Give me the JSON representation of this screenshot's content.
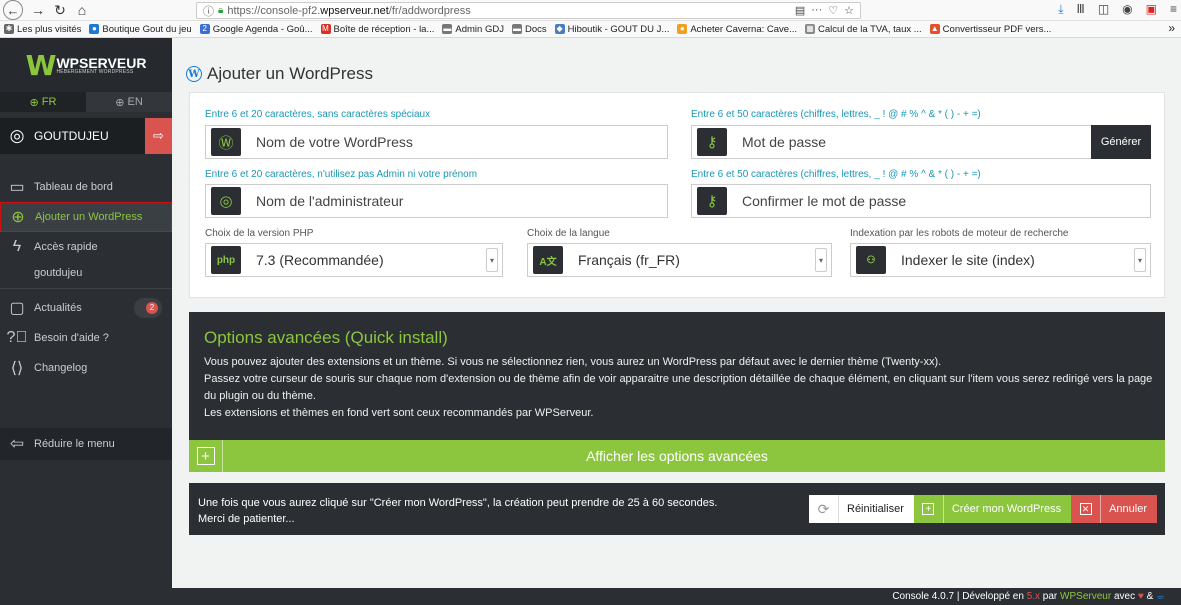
{
  "browser": {
    "url_prefix": "https://console-pf2.",
    "url_domain": "wpserveur.net",
    "url_path": "/fr/addwordpress",
    "bookmarks": [
      {
        "label": "Les plus visités",
        "icon": "gear-icon",
        "color": "#666666"
      },
      {
        "label": "Boutique Gout du jeu",
        "icon": "globe-icon",
        "color": "#1b7ad3"
      },
      {
        "label": "Google Agenda - Goû...",
        "icon": "calendar-icon",
        "color": "#3b6fd4"
      },
      {
        "label": "Boîte de réception - la...",
        "icon": "gmail-icon",
        "color": "#d93025"
      },
      {
        "label": "Admin GDJ",
        "icon": "folder-icon",
        "color": "#777777"
      },
      {
        "label": "Docs",
        "icon": "folder-icon",
        "color": "#777777"
      },
      {
        "label": "Hiboutik - GOUT DU J...",
        "icon": "hiboutik-icon",
        "color": "#4a7dc0"
      },
      {
        "label": "Acheter Caverna: Cave...",
        "icon": "shop-icon",
        "color": "#f0a020"
      },
      {
        "label": "Calcul de la TVA, taux ...",
        "icon": "calculator-icon",
        "color": "#888888"
      },
      {
        "label": "Convertisseur PDF vers...",
        "icon": "pdf-icon",
        "color": "#e5502a"
      }
    ]
  },
  "sidebar": {
    "logo_text": "WPSERVEUR",
    "logo_sub": "HÉBERGEMENT WORDPRESS",
    "lang_fr": "FR",
    "lang_en": "EN",
    "username": "GOUTDUJEU",
    "menu": [
      {
        "label": "Tableau de bord"
      },
      {
        "label": "Ajouter un WordPress"
      },
      {
        "label": "Accès rapide"
      },
      {
        "label": "goutdujeu"
      },
      {
        "label": "Actualités",
        "badge": "2"
      },
      {
        "label": "Besoin d'aide ?"
      },
      {
        "label": "Changelog"
      }
    ],
    "reduce_label": "Réduire le menu"
  },
  "main": {
    "title": "Ajouter un WordPress",
    "hints": {
      "name": "Entre 6 et 20 caractères, sans caractères spéciaux",
      "password": "Entre 6 et 50 caractères (chiffres, lettres, _ ! @ # % ^ & * ( ) - + =)",
      "admin": "Entre 6 et 20 caractères, n'utilisez pas Admin ni votre prénom",
      "confirm": "Entre 6 et 50 caractères (chiffres, lettres, _ ! @ # % ^ & * ( ) - + =)",
      "php": "Choix de la version PHP",
      "lang": "Choix de la langue",
      "index": "Indexation par les robots de moteur de recherche"
    },
    "placeholders": {
      "name": "Nom de votre WordPress",
      "password": "Mot de passe",
      "admin": "Nom de l'administrateur",
      "confirm": "Confirmer le mot de passe"
    },
    "generate_label": "Générer",
    "php_icon_text": "php",
    "php_value": "7.3 (Recommandée)",
    "lang_value": "Français (fr_FR)",
    "index_value": "Indexer le site (index)",
    "advanced": {
      "title": "Options avancées (Quick install)",
      "line1": "Vous pouvez ajouter des extensions et un thème. Si vous ne sélectionnez rien, vous aurez un WordPress par défaut avec le dernier thème (Twenty-xx).",
      "line2": "Passez votre curseur de souris sur chaque nom d'extension ou de thème afin de voir apparaitre une description détaillée de chaque élément, en cliquant sur l'item vous serez redirigé vers la page du plugin ou du thème.",
      "line3": "Les extensions et thèmes en fond vert sont ceux recommandés par WPServeur.",
      "show_label": "Afficher les options avancées"
    },
    "notice_line1": "Une fois que vous aurez cliqué sur \"Créer mon WordPress\", la création peut prendre de 25 à 60 secondes.",
    "notice_line2": "Merci de patienter...",
    "reset_label": "Réinitialiser",
    "create_label": "Créer mon WordPress",
    "cancel_label": "Annuler"
  },
  "footer": {
    "prefix": "Console 4.0.7 | Développé en ",
    "lang": "5.x",
    "by": " par ",
    "brand": "WPServeur",
    "with": " avec "
  },
  "colors": {
    "accent": "#8cc63f",
    "dark": "#2b2f33",
    "danger": "#d9534f",
    "link": "#1a98b5"
  }
}
